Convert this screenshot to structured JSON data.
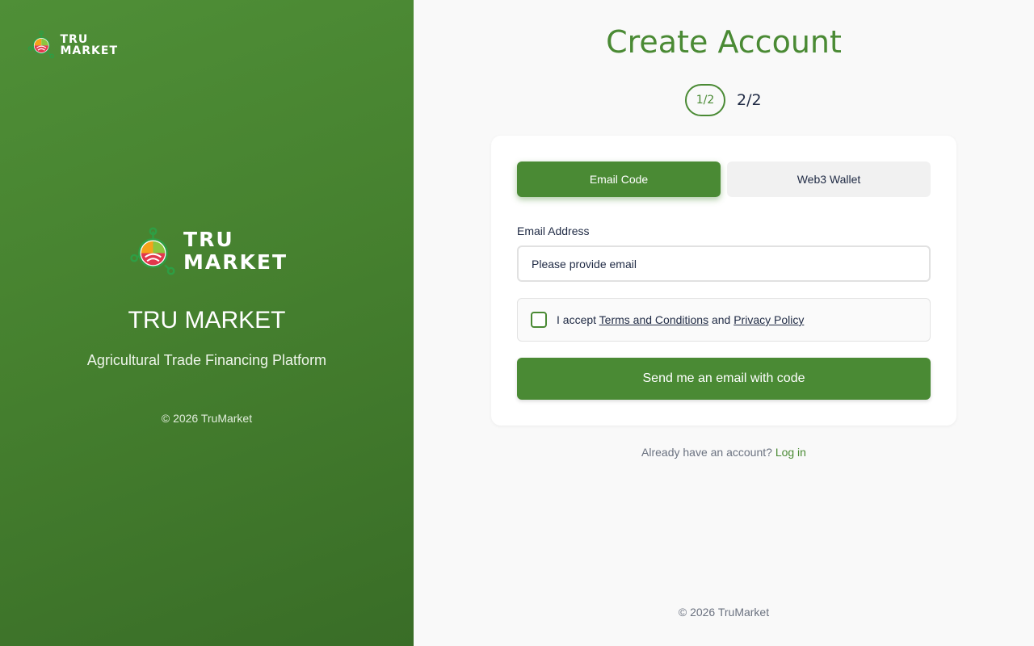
{
  "brand": {
    "logo_line1": "TRU",
    "logo_line2": "MARKET",
    "title": "TRU MARKET",
    "subtitle": "Agricultural Trade Financing Platform",
    "copyright": "© 2026 TruMarket"
  },
  "header": {
    "title": "Create Account"
  },
  "steps": {
    "current": "1/2",
    "next": "2/2"
  },
  "tabs": [
    {
      "label": "Email Code",
      "active": true
    },
    {
      "label": "Web3 Wallet",
      "active": false
    }
  ],
  "form": {
    "email_label": "Email Address",
    "email_value": "",
    "email_placeholder": "Please provide email",
    "terms_prefix": "I accept",
    "terms_link": "Terms and Conditions",
    "terms_and": "and",
    "privacy_link": "Privacy Policy",
    "terms_checked": false,
    "submit_label": "Send me an email with code"
  },
  "login": {
    "prompt": "Already have an account?",
    "link": "Log in"
  },
  "footer": {
    "copyright": "© 2026 TruMarket"
  },
  "colors": {
    "accent": "#4a8a34",
    "panel_gradient_start": "#4f8f37",
    "panel_gradient_end": "#396d27",
    "text_dark": "#1f2a44",
    "logo_orange": "#f6a21a",
    "logo_red": "#e2384d",
    "logo_green": "#2e9e44"
  }
}
